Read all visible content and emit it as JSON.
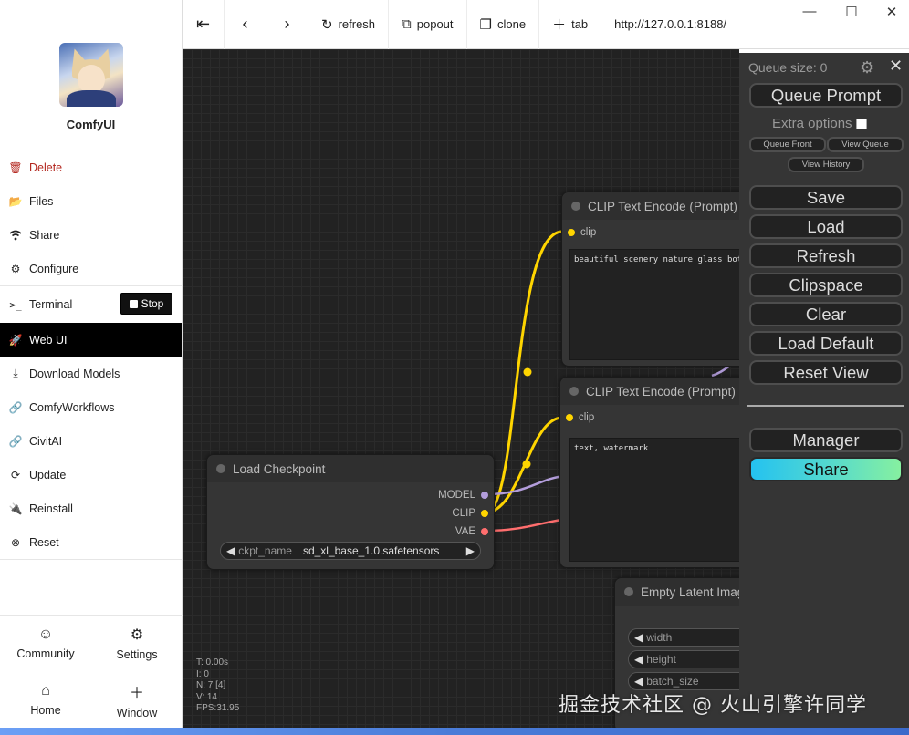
{
  "app": {
    "name": "ComfyUI"
  },
  "sidebar": {
    "items": [
      {
        "label": "Delete",
        "icon": "trash-icon"
      },
      {
        "label": "Files",
        "icon": "folder-icon"
      },
      {
        "label": "Share",
        "icon": "wifi-icon"
      },
      {
        "label": "Configure",
        "icon": "gear-icon"
      },
      {
        "label": "Terminal",
        "icon": "terminal-icon"
      },
      {
        "label": "Web UI",
        "icon": "rocket-icon"
      },
      {
        "label": "Download Models",
        "icon": "download-icon"
      },
      {
        "label": "ComfyWorkflows",
        "icon": "link-icon"
      },
      {
        "label": "CivitAI",
        "icon": "link-icon"
      },
      {
        "label": "Update",
        "icon": "refresh-icon"
      },
      {
        "label": "Reinstall",
        "icon": "plug-icon"
      },
      {
        "label": "Reset",
        "icon": "close-circle-icon"
      }
    ],
    "stop_label": "Stop",
    "bottom": [
      {
        "label": "Community",
        "icon": "smile-icon"
      },
      {
        "label": "Settings",
        "icon": "gear-icon"
      },
      {
        "label": "Home",
        "icon": "home-icon"
      },
      {
        "label": "Window",
        "icon": "plus-icon"
      }
    ]
  },
  "toolbar": {
    "refresh_label": "refresh",
    "popout_label": "popout",
    "clone_label": "clone",
    "tab_label": "tab",
    "url": "http://127.0.0.1:8188/"
  },
  "nodes": {
    "clip1": {
      "title": "CLIP Text Encode (Prompt)",
      "input": "clip",
      "text": "beautiful scenery nature glass bottle landscape, purple galaxy bottle"
    },
    "clip2": {
      "title": "CLIP Text Encode (Prompt)",
      "input": "clip",
      "text": "text, watermark"
    },
    "checkpoint": {
      "title": "Load Checkpoint",
      "outputs": [
        "MODEL",
        "CLIP",
        "VAE"
      ],
      "widget_name": "ckpt_name",
      "widget_value": "sd_xl_base_1.0.safetensors"
    },
    "latent": {
      "title": "Empty Latent Image",
      "widgets": [
        "width",
        "height",
        "batch_size"
      ]
    }
  },
  "stats": [
    "T: 0.00s",
    "I: 0",
    "N: 7 [4]",
    "V: 14",
    "FPS:31.95"
  ],
  "panel": {
    "queue_size": "Queue size: 0",
    "queue_prompt": "Queue Prompt",
    "extra_options": "Extra options",
    "queue_front": "Queue Front",
    "view_queue": "View Queue",
    "view_history": "View History",
    "save": "Save",
    "load": "Load",
    "refresh": "Refresh",
    "clipspace": "Clipspace",
    "clear": "Clear",
    "load_default": "Load Default",
    "reset_view": "Reset View",
    "manager": "Manager",
    "share": "Share"
  },
  "colors": {
    "clip_link": "#ffd500",
    "model_link": "#b39ddb",
    "vae_link": "#ff6e6e",
    "active_item": "#000000",
    "danger": "#b3261e"
  },
  "watermark": "掘金技术社区 @ 火山引擎许同学"
}
